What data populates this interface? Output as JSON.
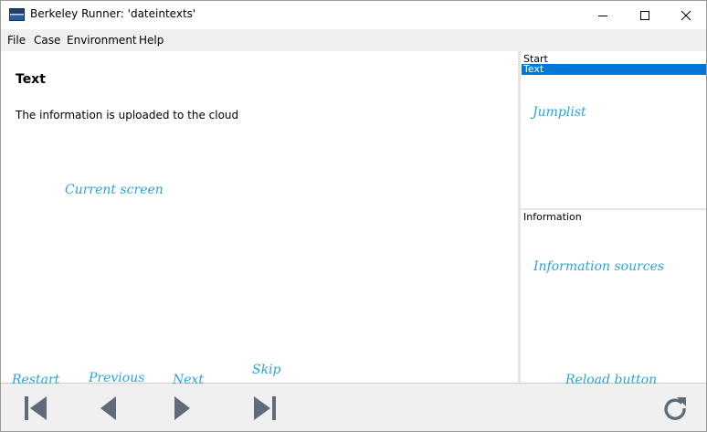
{
  "window": {
    "title": "Berkeley Runner: 'dateintexts'"
  },
  "menu": {
    "items": [
      "File",
      "Case",
      "Environment",
      "Help"
    ]
  },
  "screen": {
    "title": "Text",
    "body": "The information is uploaded to the cloud"
  },
  "jumplist": {
    "header": "Start",
    "selected_item": "Text"
  },
  "information": {
    "header": "Information"
  },
  "annotations": {
    "current_screen": "Current screen",
    "jumplist": "Jumplist",
    "information_sources": "Information sources",
    "restart": "Restart",
    "previous": "Previous",
    "next": "Next",
    "skip": "Skip",
    "reload": "Reload button"
  },
  "colors": {
    "selection": "#0078d7",
    "annotation": "#2ba3d6",
    "toolbar_icon": "#5f6b78"
  },
  "icons": {
    "restart": "skip-to-start-icon",
    "previous": "triangle-left-icon",
    "next": "triangle-right-icon",
    "skip": "skip-to-end-icon",
    "reload": "reload-icon"
  }
}
